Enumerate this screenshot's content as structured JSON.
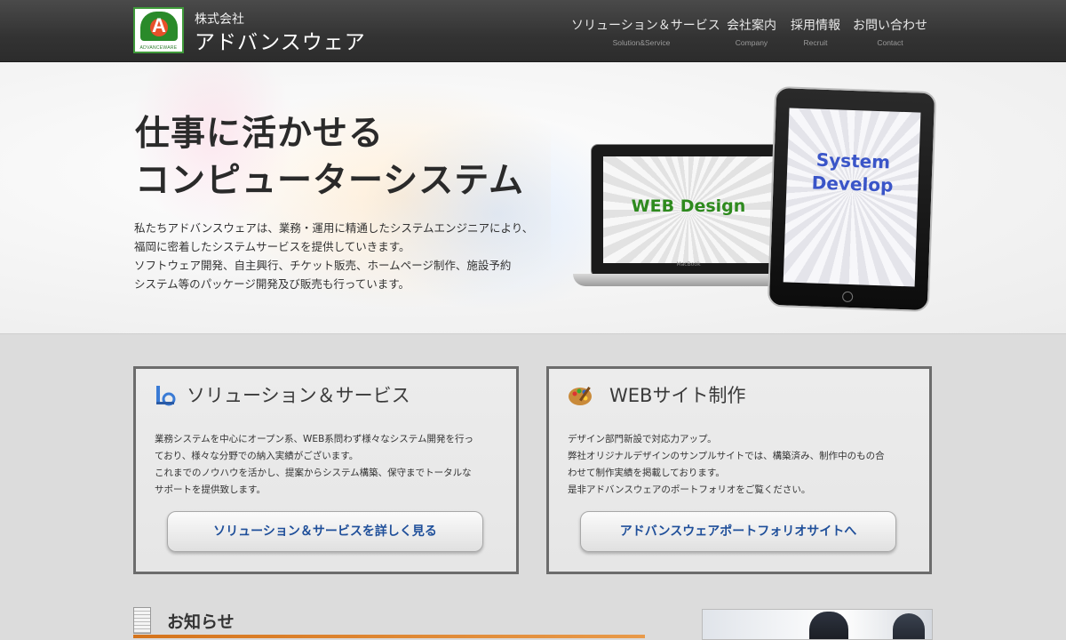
{
  "header": {
    "logo_letter": "A",
    "logo_text": "ADVANCEWARE",
    "company_prefix": "株式会社",
    "company_name": "アドバンスウェア"
  },
  "nav": [
    {
      "jp": "ソリューション＆サービス",
      "en": "Solution&Service"
    },
    {
      "jp": "会社案内",
      "en": "Company"
    },
    {
      "jp": "採用情報",
      "en": "Recruit"
    },
    {
      "jp": "お問い合わせ",
      "en": "Contact"
    }
  ],
  "hero": {
    "title_line1": "仕事に活かせる",
    "title_line2": "コンピューターシステム",
    "desc": [
      "私たちアドバンスウェアは、業務・運用に精通したシステムエンジニアにより、",
      "福岡に密着したシステムサービスを提供していきます。",
      "ソフトウェア開発、自主興行、チケット販売、ホームページ制作、施設予約",
      "システム等のパッケージ開発及び販売も行っています。"
    ],
    "laptop_text": "WEB Design",
    "laptop_brand": "MacBook",
    "tablet_line1": "System",
    "tablet_line2": "Develop"
  },
  "cards": [
    {
      "icon": "document-pen-icon",
      "title": "ソリューション＆サービス",
      "desc": [
        "業務システムを中心にオープン系、WEB系問わず様々なシステム開発を行っ",
        "ており、様々な分野での納入実績がございます。",
        "これまでのノウハウを活かし、提案からシステム構築、保守までトータルな",
        "サポートを提供致します。"
      ],
      "button": "ソリューション＆サービスを詳しく見る"
    },
    {
      "icon": "paint-palette-icon",
      "title": "WEBサイト制作",
      "desc": [
        "デザイン部門新設で対応力アップ。",
        "弊社オリジナルデザインのサンプルサイトでは、構築済み、制作中のもの合",
        "わせて制作実績を掲載しております。",
        "是非アドバンスウェアのポートフォリオをご覧ください。"
      ],
      "button": "アドバンスウェアポートフォリオサイトへ"
    }
  ],
  "news": {
    "title": "お知らせ"
  },
  "colors": {
    "header_bg": "#333333",
    "accent_green": "#2e8a1e",
    "accent_blue": "#3a55c8",
    "button_text": "#1f4f9a",
    "news_line": "#d5741c"
  }
}
